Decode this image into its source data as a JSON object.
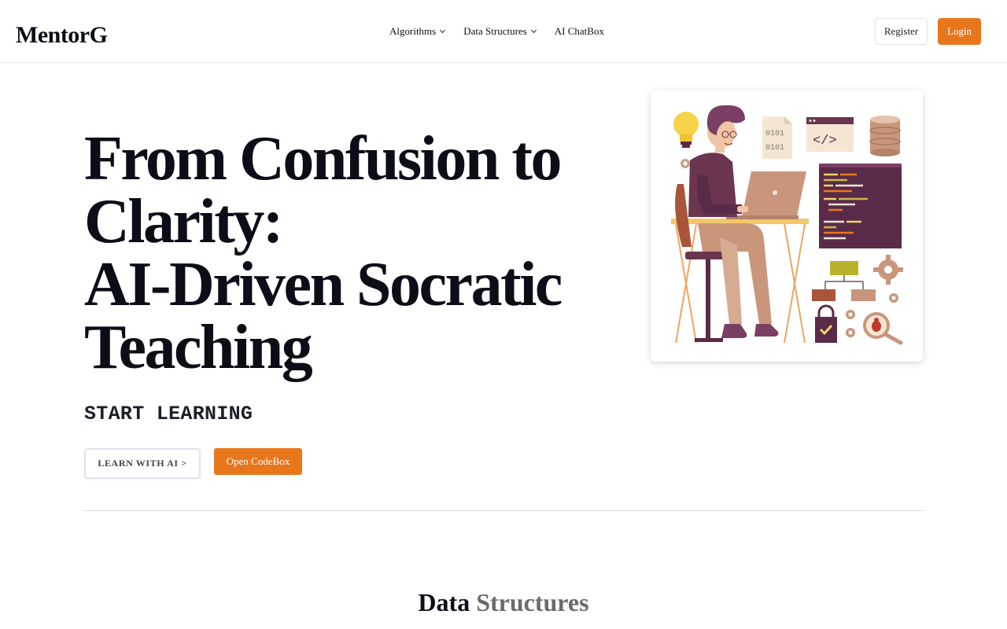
{
  "header": {
    "logo": "MentorG",
    "nav": [
      {
        "label": "Algorithms",
        "has_dropdown": true
      },
      {
        "label": "Data Structures",
        "has_dropdown": true
      },
      {
        "label": "AI ChatBox",
        "has_dropdown": false
      }
    ],
    "register_label": "Register",
    "login_label": "Login"
  },
  "hero": {
    "title_lines": [
      "From Confusion to",
      "Clarity:",
      "AI-Driven Socratic",
      "Teaching"
    ],
    "subtitle": "START LEARNING",
    "primary_button": "LEARN WITH AI >",
    "secondary_button": "Open CodeBox",
    "illustration": {
      "binary_text": [
        "0101",
        "0101"
      ],
      "code_tag": "</>"
    }
  },
  "section": {
    "title_word1": "Data",
    "title_word2": "Structures"
  },
  "colors": {
    "accent": "#e8771c",
    "text": "#0b0d17",
    "muted": "#6b6b6b"
  }
}
